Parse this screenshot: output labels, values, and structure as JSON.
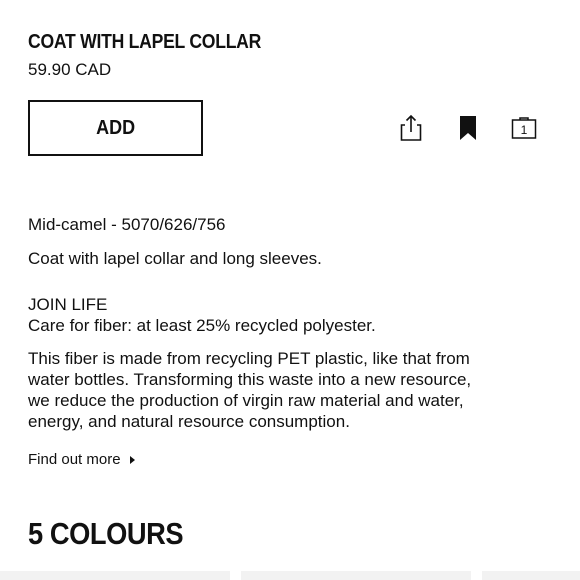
{
  "product": {
    "title": "COAT WITH LAPEL COLLAR",
    "price": "59.90 CAD"
  },
  "actions": {
    "add_label": "ADD",
    "share_icon": "share-icon",
    "bookmark_icon": "bookmark-icon",
    "bag_icon": "shopping-bag-icon",
    "bag_count": "1"
  },
  "details": {
    "colour_ref": "Mid-camel - 5070/626/756",
    "description": "Coat with lapel collar and long sleeves.",
    "join_life_heading": "JOIN LIFE",
    "join_life_care": "Care for fiber: at least 25% recycled polyester.",
    "fiber_text_lines": [
      "This fiber is made from recycling PET plastic, like that from",
      "water bottles. Transforming this waste into a new resource,",
      "we reduce the production of virgin raw material and water,",
      "energy, and natural resource consumption."
    ],
    "find_out_more": "Find out more"
  },
  "colours": {
    "heading": "5 COLOURS"
  },
  "colors": {
    "text": "#111111",
    "background": "#ffffff",
    "swatch_placeholder": "#f2f2f2"
  }
}
